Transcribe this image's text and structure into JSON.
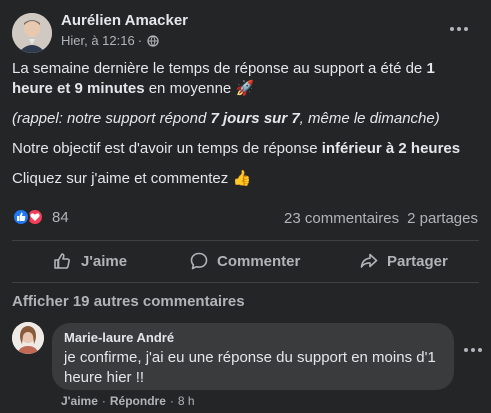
{
  "post": {
    "author": "Aurélien Amacker",
    "timestamp": "Hier, à 12:16",
    "separator": "·",
    "privacy_icon": "globe-icon",
    "body": {
      "p1_a": "La semaine dernière le temps de réponse au support a été de ",
      "p1_b": "1 heure et 9 minutes",
      "p1_c": " en moyenne ",
      "p1_emoji": "🚀",
      "p2_a": "(rappel: notre support répond ",
      "p2_b": "7 jours sur 7",
      "p2_c": ", même le dimanche)",
      "p3_a": "Notre objectif est d'avoir un temps de réponse ",
      "p3_b": "inférieur à 2 heures",
      "p4_a": "Cliquez sur j'aime et commentez ",
      "p4_emoji": "👍"
    },
    "reactions": {
      "count": "84",
      "types": [
        "like-icon",
        "love-icon"
      ]
    },
    "stats": {
      "comments": "23 commentaires",
      "shares": "2 partages"
    },
    "actions": {
      "like": "J'aime",
      "comment": "Commenter",
      "share": "Partager"
    }
  },
  "comments": {
    "more_label": "Afficher 19 autres commentaires",
    "items": [
      {
        "author": "Marie-laure André",
        "text": "je confirme, j'ai eu une réponse du support en moins d'1 heure hier !!",
        "like": "J'aime",
        "reply": "Répondre",
        "time": "8 h",
        "dot": "·"
      }
    ]
  },
  "colors": {
    "background": "#242526",
    "bubble": "#3a3b3c",
    "primary_text": "#e4e6eb",
    "secondary_text": "#b0b3b8",
    "like_blue": "#2078f4",
    "love_red": "#f33e58"
  }
}
